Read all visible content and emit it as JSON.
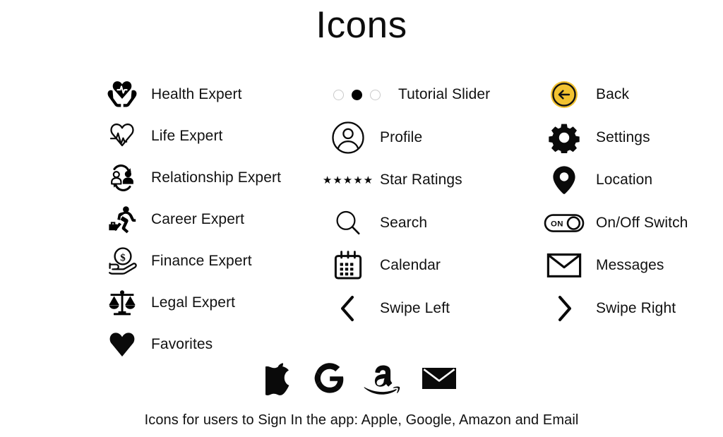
{
  "page": {
    "title": "Icons",
    "background_color": "#ffffff",
    "text_color": "#111111"
  },
  "columns": {
    "left": {
      "items": [
        {
          "icon": "health-expert-icon",
          "label": "Health Expert"
        },
        {
          "icon": "life-expert-icon",
          "label": "Life Expert"
        },
        {
          "icon": "relationship-expert-icon",
          "label": "Relationship Expert"
        },
        {
          "icon": "career-expert-icon",
          "label": "Career Expert"
        },
        {
          "icon": "finance-expert-icon",
          "label": "Finance Expert"
        },
        {
          "icon": "legal-expert-icon",
          "label": "Legal Expert"
        },
        {
          "icon": "favorites-heart-icon",
          "label": "Favorites"
        }
      ]
    },
    "middle": {
      "items": [
        {
          "icon": "tutorial-slider-dots-icon",
          "label": "Tutorial Slider",
          "dots": 3,
          "active_dot_index": 1
        },
        {
          "icon": "profile-icon",
          "label": "Profile"
        },
        {
          "icon": "star-ratings-icon",
          "label": "Star Ratings",
          "stars": "★★★★★",
          "star_count": 5
        },
        {
          "icon": "search-icon",
          "label": "Search"
        },
        {
          "icon": "calendar-icon",
          "label": "Calendar"
        },
        {
          "icon": "swipe-left-chevron-icon",
          "label": "Swipe Left"
        }
      ]
    },
    "right": {
      "items": [
        {
          "icon": "back-arrow-icon",
          "label": "Back",
          "accent_color": "#F2C230"
        },
        {
          "icon": "settings-gear-icon",
          "label": "Settings"
        },
        {
          "icon": "location-pin-icon",
          "label": "Location"
        },
        {
          "icon": "on-off-switch-icon",
          "label": "On/Off Switch",
          "switch_state": "ON"
        },
        {
          "icon": "messages-envelope-icon",
          "label": "Messages"
        },
        {
          "icon": "swipe-right-chevron-icon",
          "label": "Swipe Right"
        }
      ]
    }
  },
  "signin": {
    "items": [
      {
        "icon": "apple-logo-icon",
        "name": "Apple"
      },
      {
        "icon": "google-logo-icon",
        "name": "Google",
        "glyph": "G"
      },
      {
        "icon": "amazon-logo-icon",
        "name": "Amazon"
      },
      {
        "icon": "email-envelope-icon",
        "name": "Email"
      }
    ],
    "caption": "Icons for users to Sign In the app: Apple, Google, Amazon and Email"
  }
}
